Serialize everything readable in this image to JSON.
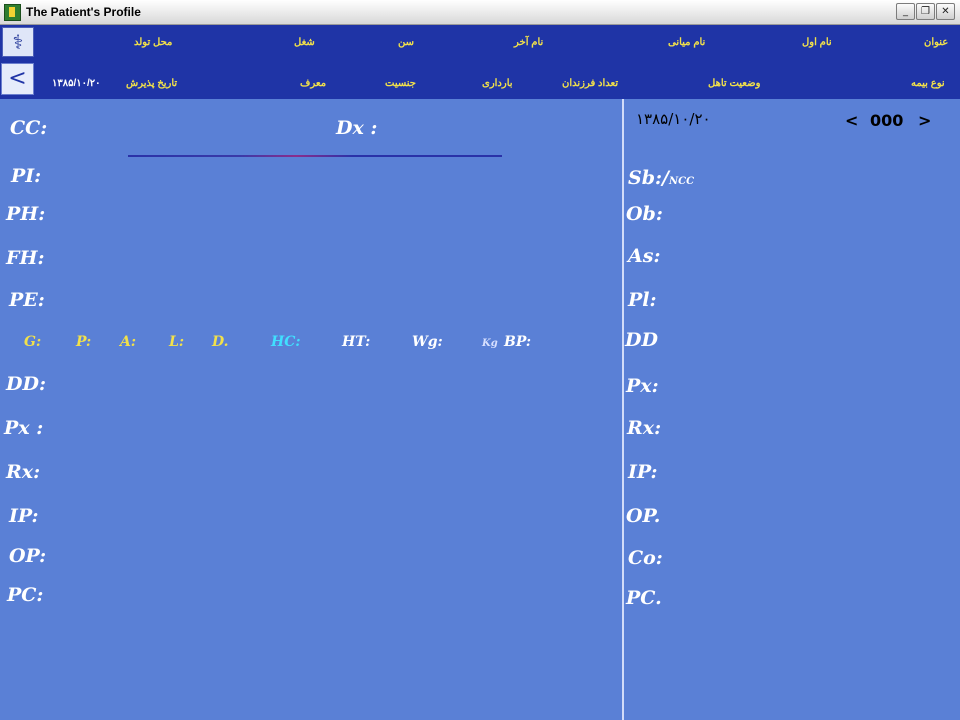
{
  "window": {
    "title": "The Patient's Profile",
    "controls": {
      "minimize": "_",
      "maximize": "❐",
      "close": "✕"
    }
  },
  "header": {
    "logo_icon": "caduceus-icon",
    "back_icon": "back-arrow-icon",
    "row1": {
      "title_label": "عنوان",
      "first_name_label": "نام اول",
      "middle_name_label": "نام میانی",
      "last_name_label": "نام آخر",
      "age_label": "سن",
      "job_label": "شغل",
      "birthplace_label": "محل تولد"
    },
    "row2": {
      "insurance_type_label": "نوع بیمه",
      "marital_status_label": "وضعیت تاهل",
      "children_count_label": "تعداد فرزندان",
      "pregnancy_label": "بارداری",
      "gender_label": "جنسیت",
      "referrer_label": "معرف",
      "admission_date_label": "تاریخ پذیرش",
      "admission_date_value": "۱۳۸۵/۱۰/۲۰"
    }
  },
  "left": {
    "cc": "CC:",
    "dx": "Dx :",
    "pi": "PI:",
    "ph": "PH:",
    "fh": "FH:",
    "pe": "PE:",
    "vitals": {
      "g": "G:",
      "p": "P:",
      "a": "A:",
      "l": "L:",
      "d": "D.",
      "hc": "HC:",
      "ht": "HT:",
      "wg": "Wg:",
      "kg": "Kg",
      "bp": "BP:"
    },
    "dd": "DD:",
    "px": "Px :",
    "rx": "Rx:",
    "ip": "IP:",
    "op": "OP:",
    "pc": "PC:"
  },
  "right": {
    "date": "۱۳۸۵/۱۰/۲۰",
    "prev": "<",
    "counter": "000",
    "next": ">",
    "sb": "Sb:/",
    "sb_sub": "NCC",
    "ob": "Ob:",
    "as": "As:",
    "pl": "Pl:",
    "dd": "DD",
    "px": "Px:",
    "rx": "Rx:",
    "ip": "IP:",
    "op": "OP.",
    "co": "Co:",
    "pc": "PC."
  },
  "colors": {
    "background": "#5a80d6",
    "header": "#1f34a6",
    "label_yellow": "#f2e14a",
    "hc_cyan": "#40e0ff"
  }
}
